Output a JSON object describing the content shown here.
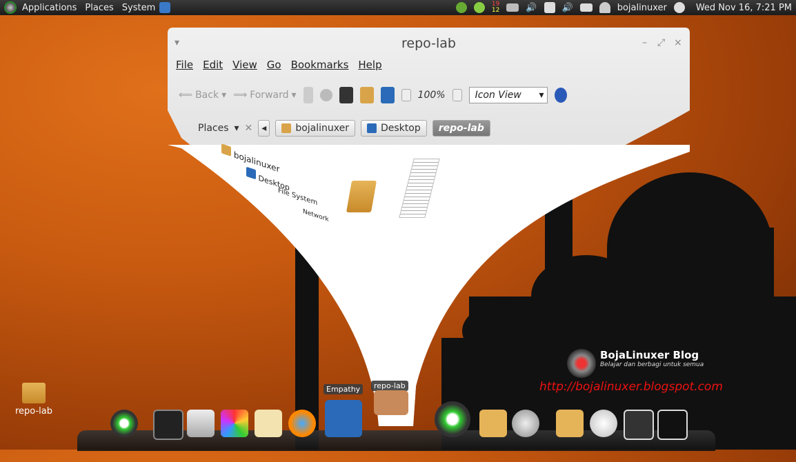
{
  "top_panel": {
    "applications": "Applications",
    "places": "Places",
    "system": "System",
    "calendar_top": "19",
    "calendar_bottom": "12",
    "user": "bojalinuxer",
    "clock": "Wed Nov 16,  7:21 PM"
  },
  "window": {
    "title": "repo-lab",
    "menu": [
      "File",
      "Edit",
      "View",
      "Go",
      "Bookmarks",
      "Help"
    ],
    "toolbar": {
      "back": "Back",
      "forward": "Forward",
      "zoom": "100%",
      "view_mode": "Icon View"
    },
    "sidebar": {
      "header": "Places",
      "items": [
        "bojalinuxer",
        "Desktop",
        "File System",
        "Network"
      ]
    },
    "breadcrumbs": [
      "bojalinuxer",
      "Desktop",
      "repo-lab"
    ]
  },
  "desktop": {
    "folder_label": "repo-lab"
  },
  "blog": {
    "title": "BojaLinuxer Blog",
    "subtitle": "Belajar dan berbagi untuk semua",
    "url": "http://bojalinuxer.blogspot.com"
  },
  "dock": {
    "tooltip_empathy": "Empathy",
    "tooltip_repo": "repo-lab"
  }
}
